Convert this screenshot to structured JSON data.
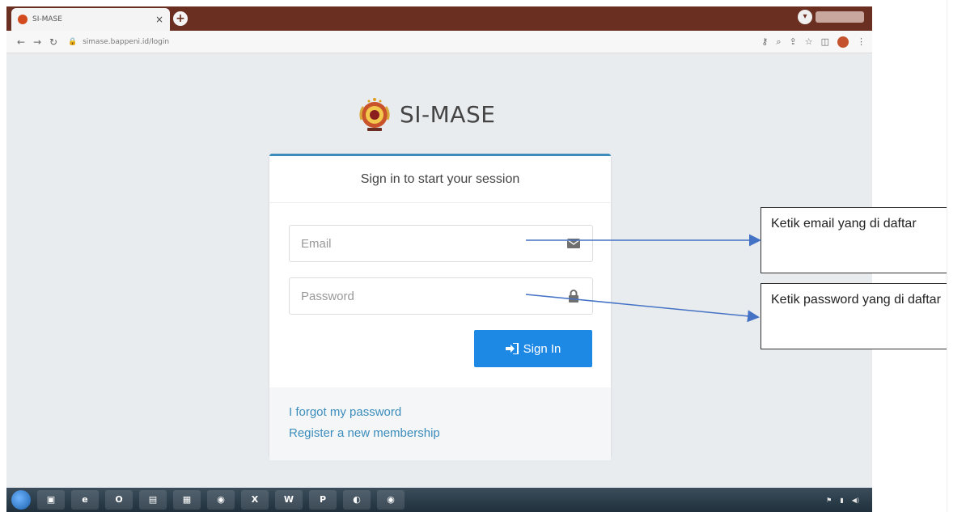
{
  "browser": {
    "tab_title": "SI-MASE",
    "tab_close": "×",
    "new_tab": "+",
    "url": "simase.bappeni.id/login"
  },
  "page": {
    "brand_name": "SI-MASE",
    "card_header": "Sign in to start your session",
    "email_placeholder": "Email",
    "password_placeholder": "Password",
    "signin_label": "Sign In",
    "forgot_link": "I forgot my password",
    "register_link": "Register a new membership"
  },
  "annotations": {
    "email_note": "Ketik email yang di daftar",
    "password_note": "Ketik password yang di daftar"
  },
  "colors": {
    "accent": "#3c8dbc",
    "button": "#1e88e5",
    "titlebar": "#6b2f22",
    "arrow": "#4472c4"
  },
  "icons": {
    "email": "envelope-icon",
    "password": "lock-icon",
    "signin": "sign-in-icon"
  }
}
